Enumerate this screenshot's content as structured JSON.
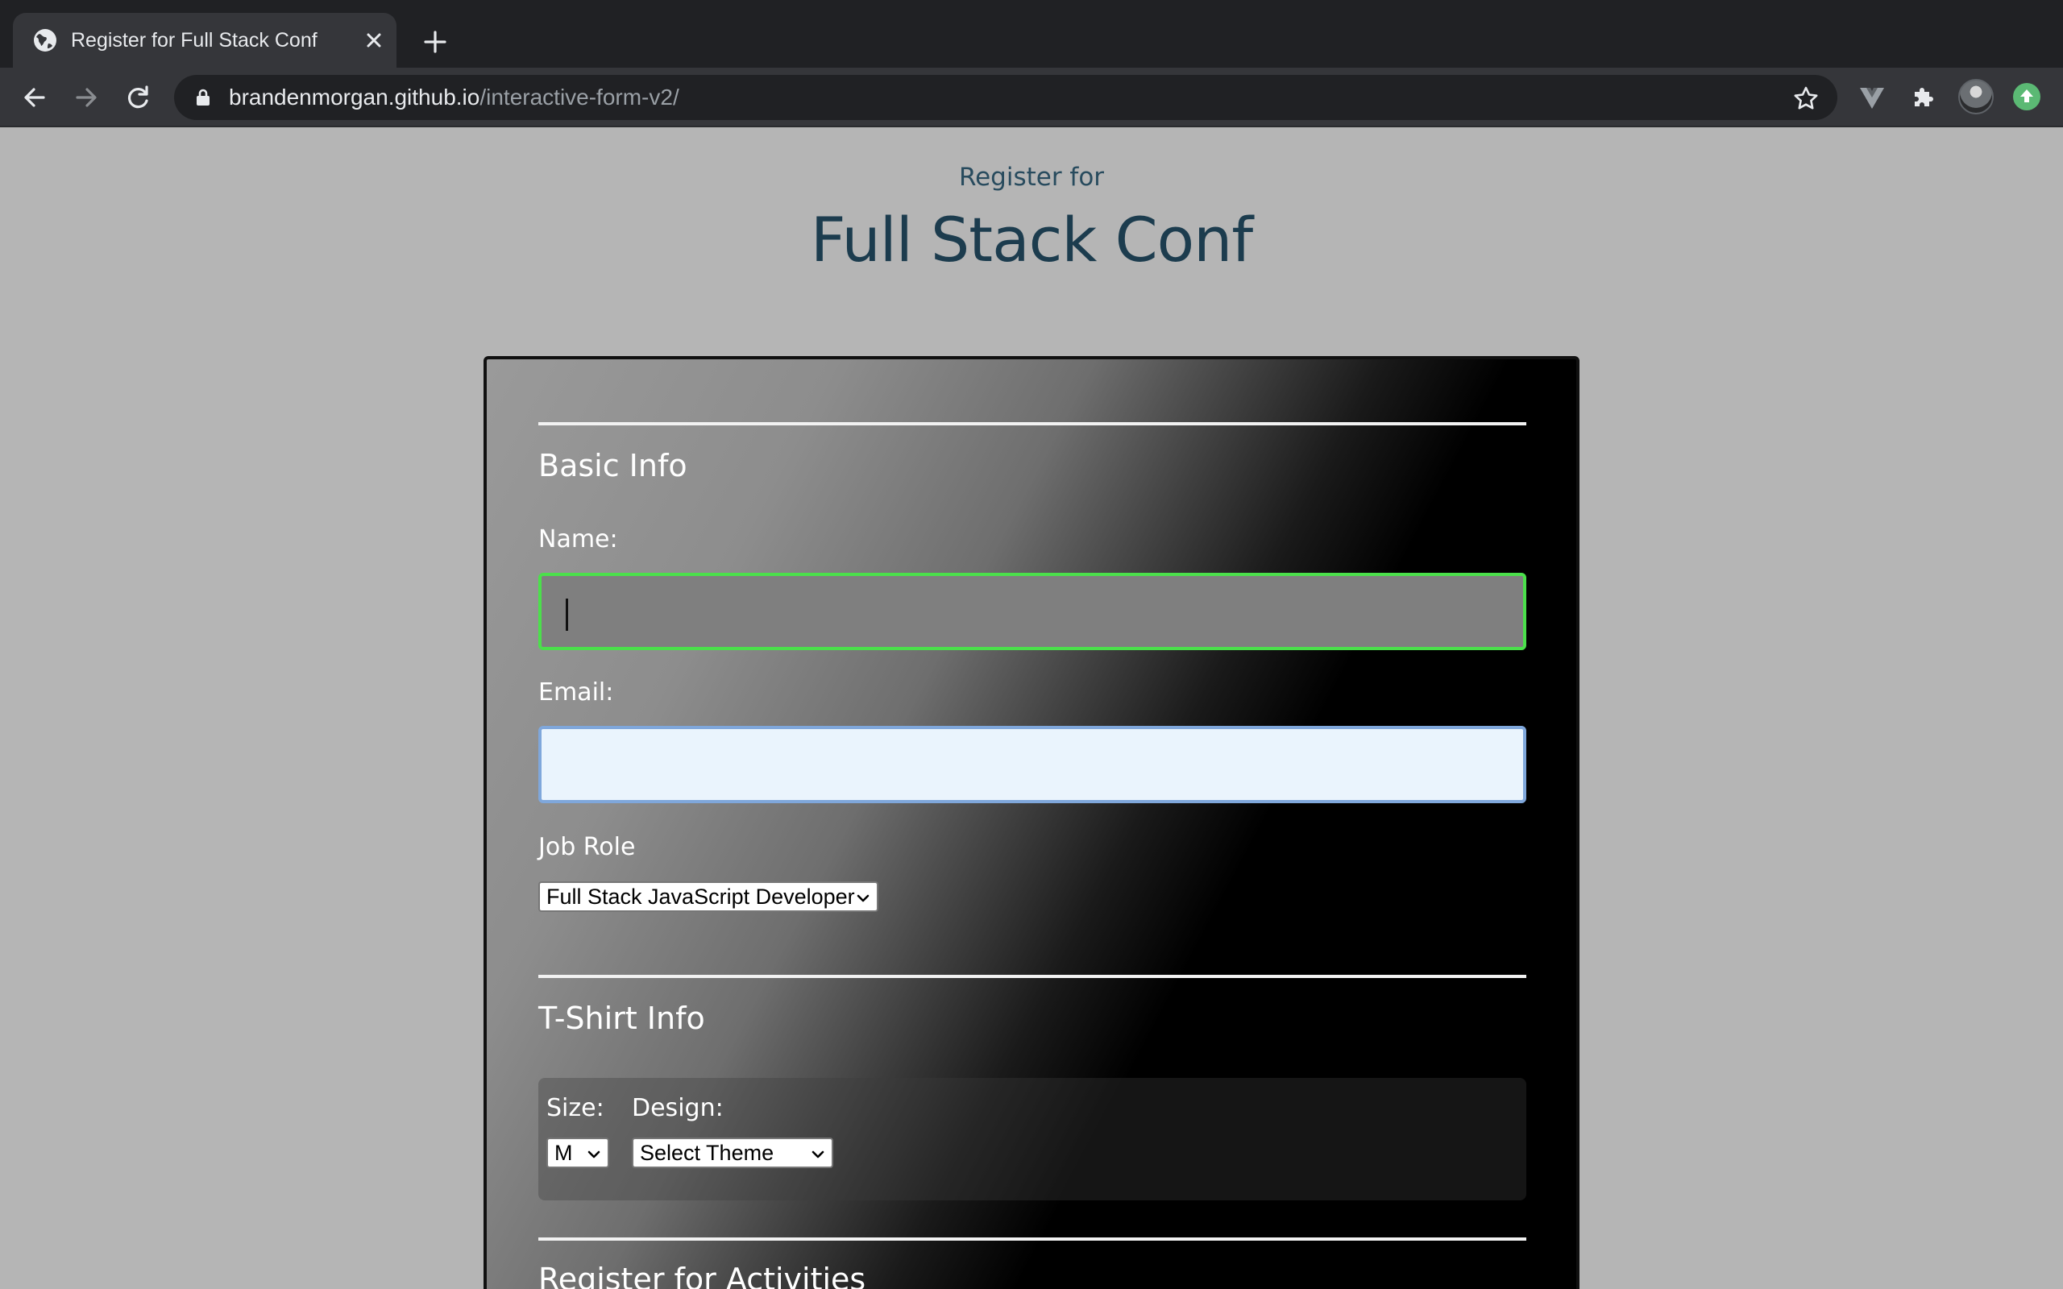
{
  "browser": {
    "tab_title": "Register for Full Stack Conf",
    "url_host": "brandenmorgan.github.io",
    "url_path": "/interactive-form-v2/"
  },
  "page": {
    "pre_title": "Register for",
    "title": "Full Stack Conf"
  },
  "basic_info": {
    "legend": "Basic Info",
    "name_label": "Name:",
    "name_value": "",
    "email_label": "Email:",
    "email_value": "",
    "job_role_label": "Job Role",
    "job_role_selected": "Full Stack JavaScript Developer"
  },
  "tshirt_info": {
    "legend": "T-Shirt Info",
    "size_label": "Size:",
    "size_selected": "M",
    "design_label": "Design:",
    "design_selected": "Select Theme"
  },
  "activities": {
    "legend": "Register for Activities"
  },
  "colors": {
    "chrome_dark": "#202124",
    "chrome_toolbar": "#35363a",
    "page_bg": "#b5b5b5",
    "title_color": "#1c3c4e",
    "focus_green": "#4be04b",
    "email_bg": "#eaf4fd"
  }
}
